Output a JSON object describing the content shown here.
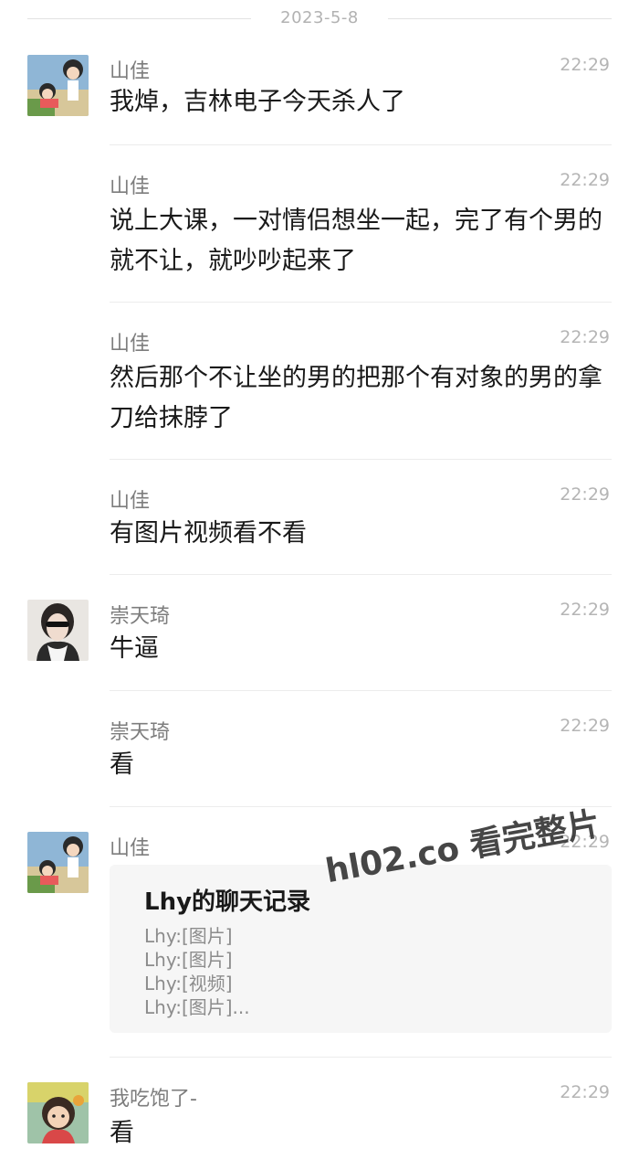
{
  "date_separator": "2023-5-8",
  "messages": [
    {
      "sender": "山佳",
      "time": "22:29",
      "text": "我焯，吉林电子今天杀人了"
    },
    {
      "sender": "山佳",
      "time": "22:29",
      "text": "说上大课，一对情侣想坐一起，完了有个男的就不让，就吵吵起来了"
    },
    {
      "sender": "山佳",
      "time": "22:29",
      "text": "然后那个不让坐的男的把那个有对象的男的拿刀给抹脖了"
    },
    {
      "sender": "山佳",
      "time": "22:29",
      "text": "有图片视频看不看"
    },
    {
      "sender": "崇天琦",
      "time": "22:29",
      "text": "牛逼"
    },
    {
      "sender": "崇天琦",
      "time": "22:29",
      "text": "看"
    },
    {
      "sender": "山佳",
      "time": "22:29",
      "text": ""
    },
    {
      "sender": "我吃饱了-",
      "time": "22:29",
      "text": "看"
    }
  ],
  "chat_record_card": {
    "title": "Lhy的聊天记录",
    "lines": [
      "Lhy:[图片]",
      "Lhy:[图片]",
      "Lhy:[视频]",
      "Lhy:[图片]..."
    ]
  },
  "watermark": "hl02.co 看完整片"
}
